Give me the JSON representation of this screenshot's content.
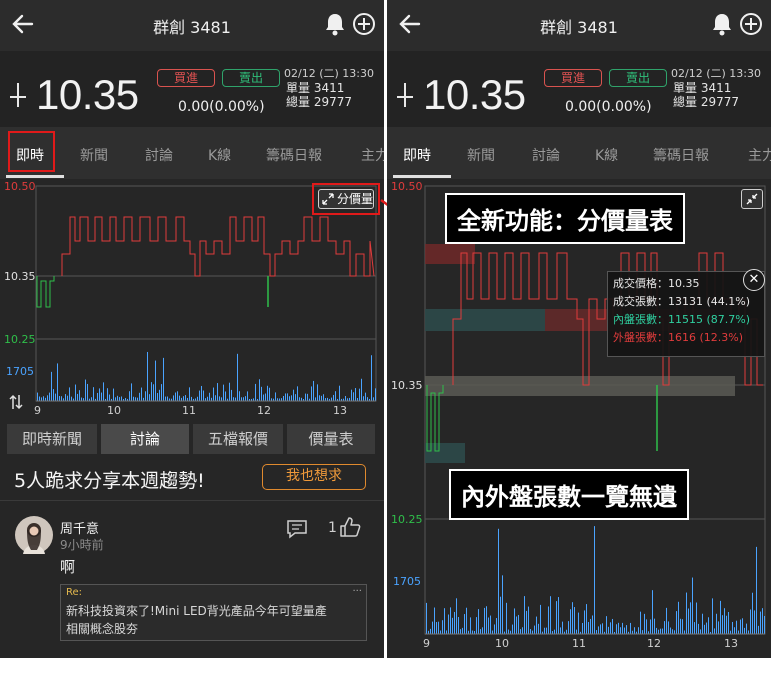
{
  "header": {
    "title": "群創 3481"
  },
  "quote": {
    "price": "10.35",
    "change": "0.00(0.00%)",
    "buy_label": "買進",
    "sell_label": "賣出",
    "datetime": "02/12 (二) 13:30",
    "single_vol": "單量 3411",
    "total_vol": "總量 29777"
  },
  "tabs": [
    "即時",
    "新聞",
    "討論",
    "K線",
    "籌碼日報",
    "主力"
  ],
  "chart": {
    "y_top": "10.50",
    "y_mid": "10.35",
    "y_low": "10.25",
    "vol_max": "1705",
    "x_ticks": [
      "9",
      "10",
      "11",
      "12",
      "13"
    ],
    "badge_label": "分價量",
    "colors": {
      "up": "#e03c3c",
      "down": "#2fbf4a",
      "volume": "#4aa3ff"
    }
  },
  "subtabs": [
    "即時新聞",
    "討論",
    "五檔報價",
    "價量表"
  ],
  "discussion": {
    "headline": "5人跪求分享本週趨勢!",
    "ask_button": "我也想求",
    "post": {
      "author": "周千意",
      "time": "9小時前",
      "like_count": "1",
      "text": "啊",
      "quote_prefix": "Re:",
      "quote_more": "...",
      "quote_text_1": "新科技投資來了!Mini LED背光產品今年可望量產",
      "quote_text_2": "相關概念股夯"
    }
  },
  "right_panel": {
    "callout_top": "全新功能：分價量表",
    "callout_bottom": "內外盤張數一覽無遺",
    "tooltip": {
      "price": "成交價格：10.35",
      "volume": "成交張數：13131 (44.1%)",
      "inner": "內盤張數：11515 (87.7%)",
      "outer": "外盤張數：1616 (12.3%)"
    }
  }
}
